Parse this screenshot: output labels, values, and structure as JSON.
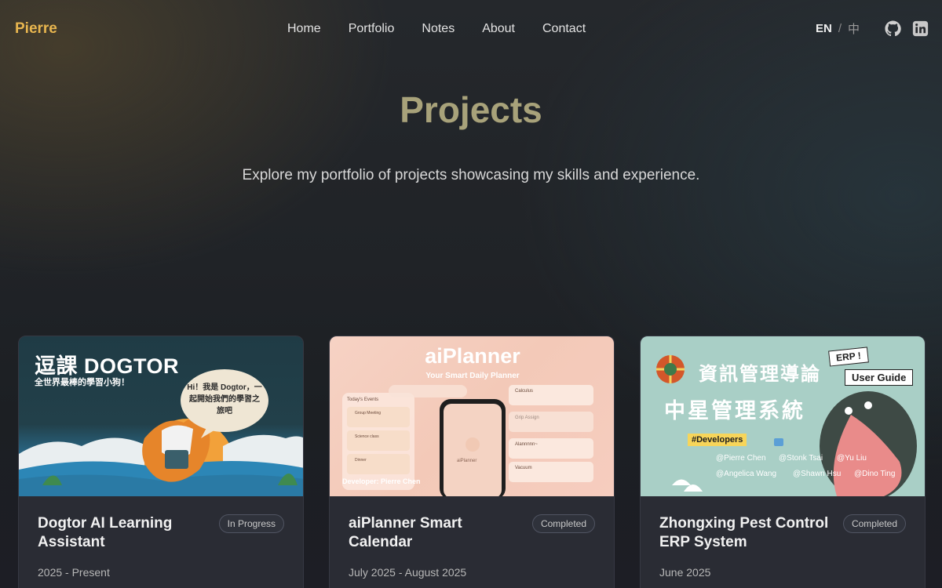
{
  "nav": {
    "brand": "Pierre",
    "links": [
      "Home",
      "Portfolio",
      "Notes",
      "About",
      "Contact"
    ],
    "lang_active": "EN",
    "lang_sep": "/",
    "lang_other": "中",
    "icons": [
      "github-icon",
      "linkedin-icon"
    ]
  },
  "hero": {
    "title": "Projects",
    "subtitle": "Explore my portfolio of projects showcasing my skills and experience."
  },
  "projects": [
    {
      "title": "Dogtor AI Learning Assistant",
      "status": "In Progress",
      "date": "2025 - Present",
      "thumb": {
        "heading": "逗課 DOGTOR",
        "tagline": "全世界最棒的學習小狗！",
        "bubble": "Hi！我是 Dogtor，一起開始我們的學習之旅吧"
      }
    },
    {
      "title": "aiPlanner Smart Calendar",
      "status": "Completed",
      "date": "July 2025 - August 2025",
      "thumb": {
        "heading": "aiPlanner",
        "tagline": "Your Smart Daily Planner",
        "credit": "Developer: Pierre Chen",
        "events_header": "Today's Events",
        "events": [
          "Group Meeting",
          "Science class",
          "Dinner"
        ],
        "tasks": [
          "Calculus",
          "Grip Assign",
          "Alannnnn~",
          "Vacuum"
        ],
        "phone_label": "aiPlanner"
      }
    },
    {
      "title": "Zhongxing Pest Control ERP System",
      "status": "Completed",
      "date": "June 2025",
      "thumb": {
        "heading": "資訊管理導論",
        "heading2": "中星管理系統",
        "tag_erp": "ERP !",
        "tag_guide": "User Guide",
        "tag_dev": "#Developers",
        "devs": [
          "@Pierre Chen",
          "@Stonk Tsai",
          "@Yu Liu",
          "@Angelica Wang",
          "@Shawn Hsu",
          "@Dino Ting"
        ]
      }
    }
  ],
  "colors": {
    "brand": "#e8b64f",
    "hero_title": "#a8a27a",
    "card_bg": "#2a2c34"
  }
}
